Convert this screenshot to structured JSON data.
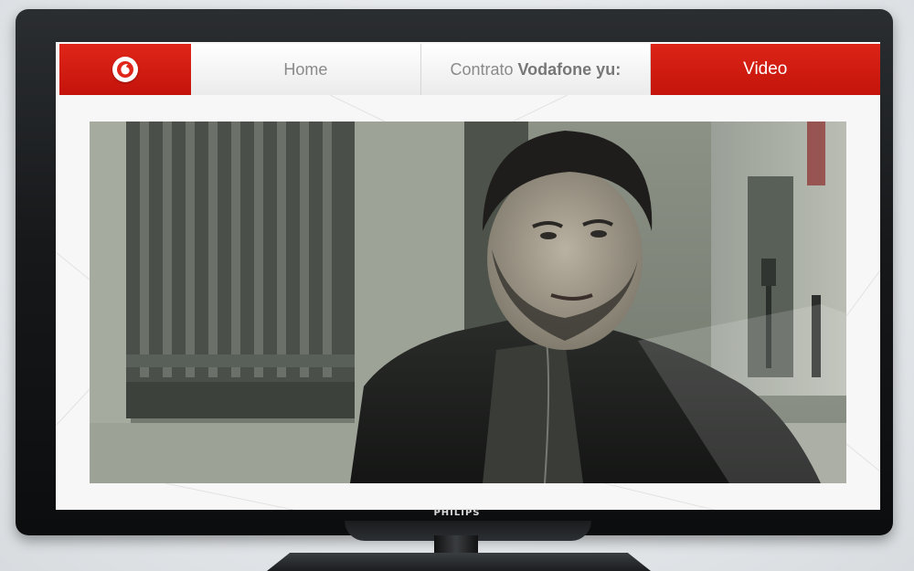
{
  "tv": {
    "brand": "PHILIPS"
  },
  "nav": {
    "logo_icon": "vodafone-logo-icon",
    "home_label": "Home",
    "contract_prefix": "Contrato",
    "contract_brand": "Vodafone yu:",
    "video_label": "Video"
  },
  "colors": {
    "accent_red": "#d9201a",
    "nav_text_gray": "#8a8a8a",
    "tv_frame": "#16181a"
  },
  "video": {
    "content": "man in dark jacket on city street"
  }
}
